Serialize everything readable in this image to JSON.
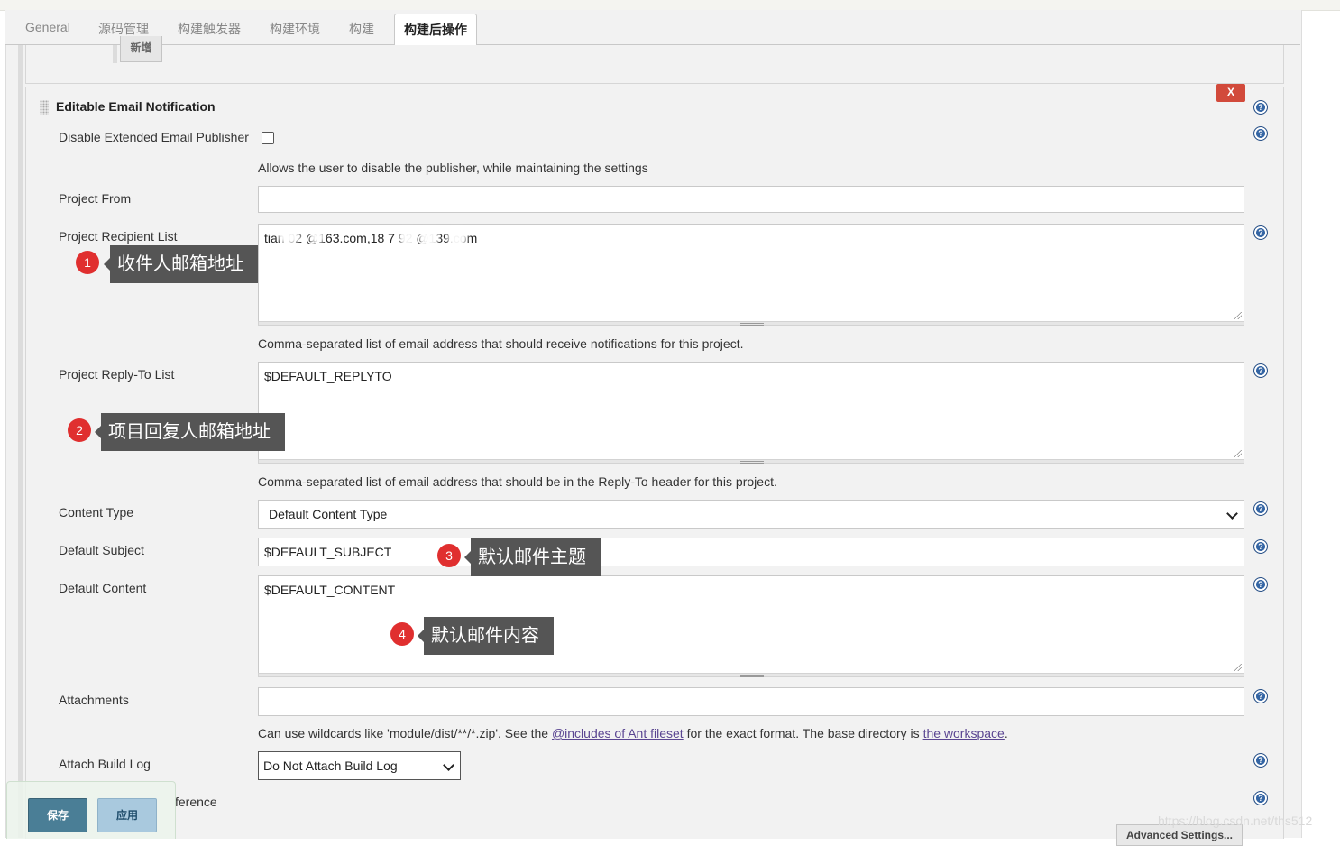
{
  "tabs": [
    "General",
    "源码管理",
    "构建触发器",
    "构建环境",
    "构建",
    "构建后操作"
  ],
  "prev_section": {
    "add_button": "新增"
  },
  "section": {
    "title": "Editable Email Notification",
    "delete_label": "X",
    "help_icon": "?"
  },
  "fields": {
    "disable_publisher": {
      "label": "Disable Extended Email Publisher",
      "checked": false,
      "description": "Allows the user to disable the publisher, while maintaining the settings"
    },
    "project_from": {
      "label": "Project From",
      "value": ""
    },
    "recipient_list": {
      "label": "Project Recipient List",
      "value": "tian   02  @163.com,18  7    92     @139.com",
      "description": "Comma-separated list of email address that should receive notifications for this project."
    },
    "reply_to": {
      "label": "Project Reply-To List",
      "value": "$DEFAULT_REPLYTO",
      "description": "Comma-separated list of email address that should be in the Reply-To header for this project."
    },
    "content_type": {
      "label": "Content Type",
      "value": "Default Content Type"
    },
    "default_subject": {
      "label": "Default Subject",
      "value": "$DEFAULT_SUBJECT"
    },
    "default_content": {
      "label": "Default Content",
      "value": "$DEFAULT_CONTENT"
    },
    "attachments": {
      "label": "Attachments",
      "value": "",
      "desc_prefix": "Can use wildcards like 'module/dist/**/*.zip'. See the ",
      "desc_link1": "@includes of Ant fileset",
      "desc_mid": " for the exact format. The base directory is ",
      "desc_link2": "the workspace",
      "desc_suffix": "."
    },
    "attach_build_log": {
      "label": "Attach Build Log",
      "value": "Do Not Attach Build Log"
    },
    "content_token_reference": {
      "label_visible": "ference"
    }
  },
  "callouts": [
    {
      "num": "1",
      "text": "收件人邮箱地址"
    },
    {
      "num": "2",
      "text": "项目回复人邮箱地址"
    },
    {
      "num": "3",
      "text": "默认邮件主题"
    },
    {
      "num": "4",
      "text": "默认邮件内容"
    }
  ],
  "footer": {
    "save": "保存",
    "apply": "应用",
    "advanced": "Advanced Settings..."
  },
  "watermark": "https://blog.csdn.net/ths512",
  "colors": {
    "delete": "#d24a3b",
    "save": "#4a7e96",
    "apply": "#a9c9de",
    "badge": "#e02f2f",
    "help": "#3465a4"
  }
}
